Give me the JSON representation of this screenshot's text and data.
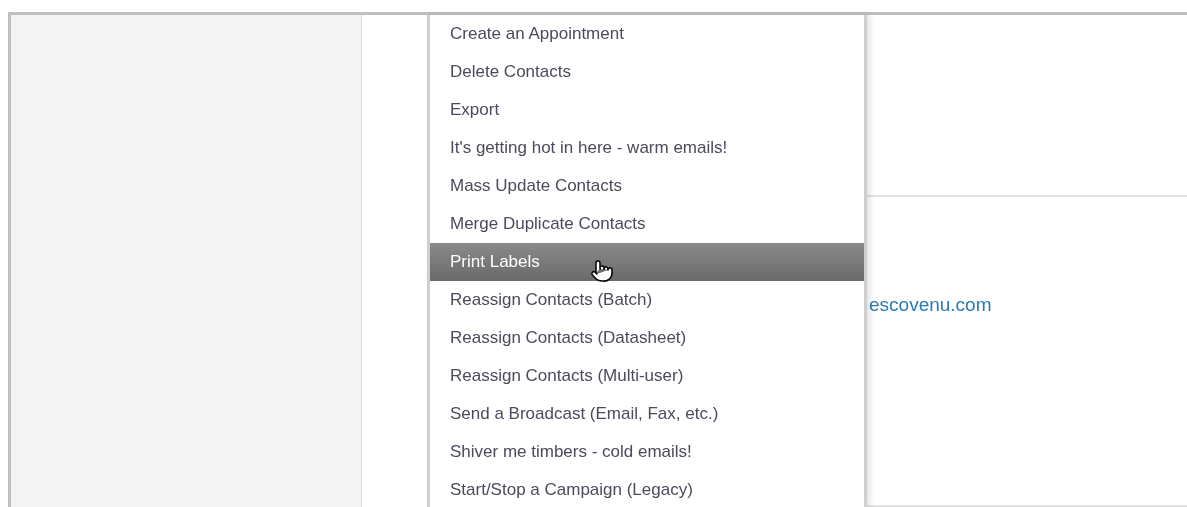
{
  "menu": {
    "items": [
      {
        "label": "Create an Appointment",
        "selected": false
      },
      {
        "label": "Delete Contacts",
        "selected": false
      },
      {
        "label": "Export",
        "selected": false
      },
      {
        "label": "It's getting hot in here - warm emails!",
        "selected": false
      },
      {
        "label": "Mass Update Contacts",
        "selected": false
      },
      {
        "label": "Merge Duplicate Contacts",
        "selected": false
      },
      {
        "label": "Print Labels",
        "selected": true
      },
      {
        "label": "Reassign Contacts (Batch)",
        "selected": false
      },
      {
        "label": "Reassign Contacts (Datasheet)",
        "selected": false
      },
      {
        "label": "Reassign Contacts (Multi-user)",
        "selected": false
      },
      {
        "label": "Send a Broadcast (Email, Fax, etc.)",
        "selected": false
      },
      {
        "label": "Shiver me timbers - cold emails!",
        "selected": false
      },
      {
        "label": "Start/Stop a Campaign (Legacy)",
        "selected": false
      }
    ]
  },
  "link": "escovenu.com"
}
